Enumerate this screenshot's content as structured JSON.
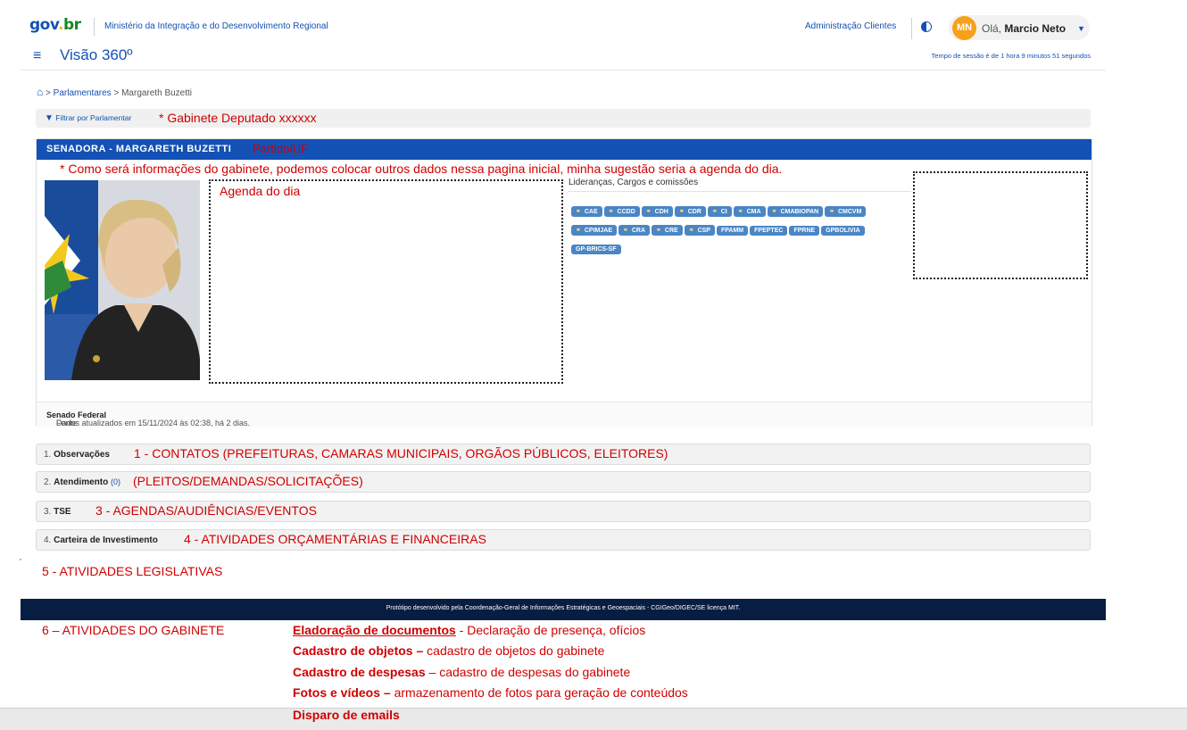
{
  "header": {
    "logo_gov": "gov",
    "logo_dot": ".",
    "logo_br": "br",
    "ministry": "Ministério da Integração e do Desenvolvimento Regional",
    "admin_link": "Administração Clientes",
    "avatar_initials": "MN",
    "greeting": "Olá,",
    "user_name": "Marcio Neto",
    "app_title": "Visão 360º",
    "session": "Tempo de sessão é de 1 hora 9 minutos 51 segundos"
  },
  "breadcrumb": {
    "items": [
      "Parlamentares",
      "Margareth Buzetti"
    ],
    "separator": ">"
  },
  "filter": {
    "label": "Filtrar por Parlamentar",
    "note": "* Gabinete Deputado xxxxxx"
  },
  "card": {
    "title": "SENADORA - MARGARETH BUZETTI",
    "party_note": "Partido/UF",
    "note": "* Como será informações do gabinete, podemos colocar outros dados nessa pagina inicial, minha sugestão seria a agenda do dia.",
    "agenda_label": "Agenda do dia",
    "leaderships_title": "Lideranças, Cargos e comissões",
    "chips_linked": [
      "CAE",
      "CCDD",
      "CDH",
      "CDR",
      "CI",
      "CMA",
      "CMABIOPAN",
      "CMCVM",
      "CPIMJAE",
      "CRA",
      "CRE",
      "CSP"
    ],
    "chips_plain": [
      "FPAMM",
      "FPEPTEC",
      "FPRNE",
      "GPBOLIVIA",
      "GP-BRICS-SF"
    ],
    "updated_text": "Dados atualizados em 15/11/2024 às 02:38, há 2 dias.",
    "source_label": "Fonte:",
    "source_value": "Senado Federal"
  },
  "accordion": [
    {
      "num": "1.",
      "label": "Observações",
      "count": "",
      "note": "1 - CONTATOS  (PREFEITURAS, CAMARAS MUNICIPAIS, ORGÃOS PÚBLICOS, ELEITORES)"
    },
    {
      "num": "2.",
      "label": "Atendimento",
      "count": "(0)",
      "note": "(PLEITOS/DEMANDAS/SOLICITAÇÕES)"
    },
    {
      "num": "3.",
      "label": "TSE",
      "count": "",
      "note": "3 - AGENDAS/AUDIÊNCIAS/EVENTOS"
    },
    {
      "num": "4.",
      "label": "Carteira de Investimento",
      "count": "",
      "note": "4 - ATIVIDADES ORÇAMENTÁRIAS E FINANCEIRAS"
    }
  ],
  "activity5": "5 - ATIVIDADES LEGISLATIVAS",
  "footer": "Protótipo desenvolvido pela Coordenação-Geral de Informações Estratégicas e Geoespaciais - CGIGeo/DIGEC/SE licença MIT.",
  "activity6": "6 – ATIVIDADES DO GABINETE",
  "gabinete": [
    {
      "bold": "Eladoração de documentos",
      "rest": " - Declaração de presença, ofícios"
    },
    {
      "bold": "Cadastro de objetos –",
      "rest": " cadastro de objetos do gabinete"
    },
    {
      "bold": "Cadastro de despesas",
      "rest": " – cadastro de despesas do gabinete"
    },
    {
      "bold": "Fotos e vídeos –",
      "rest": " armazenamento de fotos para geração de conteúdos"
    },
    {
      "bold": "Disparo de emails",
      "rest": ""
    }
  ],
  "colors": {
    "primary": "#1351b4",
    "annotation": "#d00000",
    "footer": "#071d41",
    "avatar": "#f6a11b"
  }
}
